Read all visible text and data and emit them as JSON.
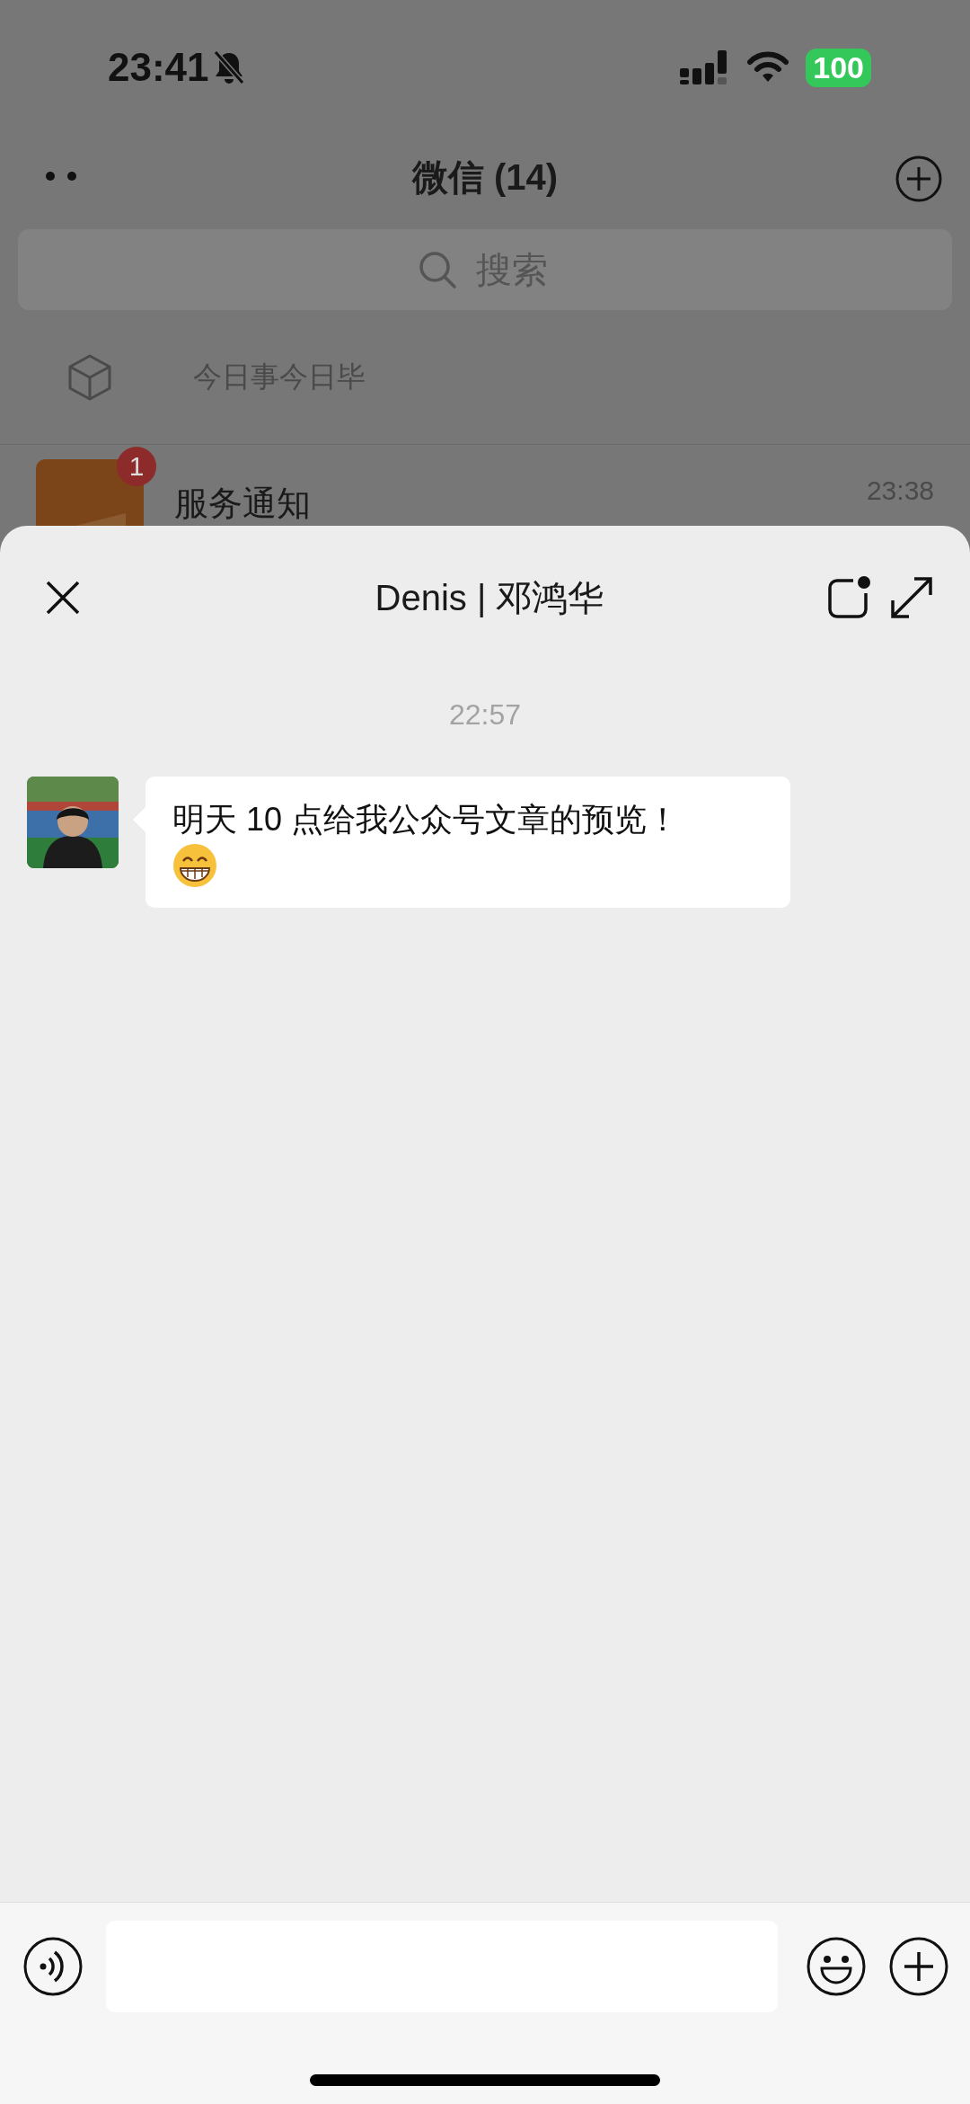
{
  "status_bar": {
    "time": "23:41",
    "silent": true,
    "battery": "100"
  },
  "chat_list": {
    "title": "微信 (14)",
    "search": {
      "placeholder": "搜索"
    },
    "shortcut": {
      "label": "今日事今日毕"
    },
    "rows": [
      {
        "name": "服务通知",
        "time": "23:38",
        "badge": "1"
      }
    ]
  },
  "chat": {
    "title": "Denis | 邓鸿华",
    "messages": [
      {
        "kind": "timestamp",
        "text": "22:57"
      },
      {
        "kind": "received",
        "text": "明天 10 点给我公众号文章的预览！",
        "emoji": true
      }
    ]
  }
}
